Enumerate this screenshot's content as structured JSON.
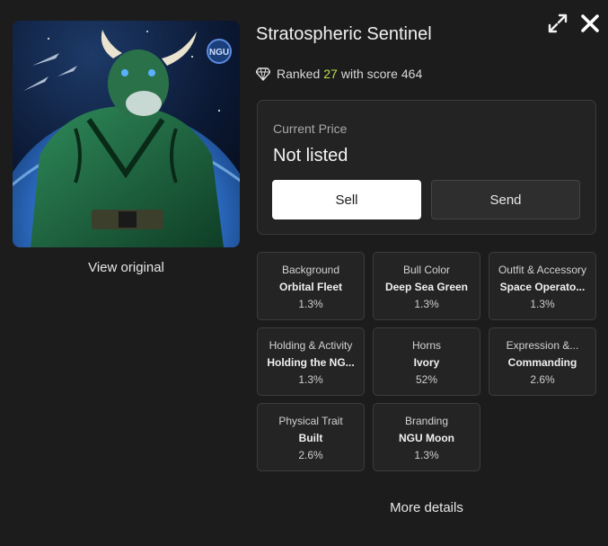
{
  "nft": {
    "title": "Stratospheric Sentinel",
    "view_original_label": "View original",
    "image_badge": "NGU"
  },
  "ranking": {
    "prefix": "Ranked",
    "rank": "27",
    "middle": "with score",
    "score": "464",
    "rank_color": "#b6e04a"
  },
  "price": {
    "label": "Current Price",
    "value": "Not listed",
    "sell_label": "Sell",
    "send_label": "Send"
  },
  "traits": [
    {
      "name": "Background",
      "value": "Orbital Fleet",
      "pct": "1.3%"
    },
    {
      "name": "Bull Color",
      "value": "Deep Sea Green",
      "pct": "1.3%"
    },
    {
      "name": "Outfit & Accessory",
      "value": "Space Operato...",
      "pct": "1.3%"
    },
    {
      "name": "Holding & Activity",
      "value": "Holding the NG...",
      "pct": "1.3%"
    },
    {
      "name": "Horns",
      "value": "Ivory",
      "pct": "52%"
    },
    {
      "name": "Expression &...",
      "value": "Commanding",
      "pct": "2.6%"
    },
    {
      "name": "Physical Trait",
      "value": "Built",
      "pct": "2.6%"
    },
    {
      "name": "Branding",
      "value": "NGU Moon",
      "pct": "1.3%"
    }
  ],
  "more_details_label": "More details",
  "icons": {
    "expand": "expand-icon",
    "close": "close-icon",
    "gem": "diamond-icon"
  }
}
